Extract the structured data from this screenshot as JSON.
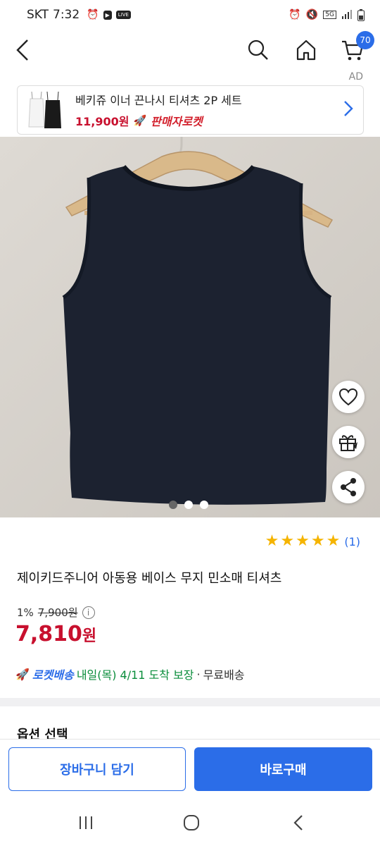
{
  "status_bar": {
    "carrier": "SKT",
    "time": "7:32",
    "live_badge": "LIVE",
    "network": "5G"
  },
  "header": {
    "cart_count": "70"
  },
  "ad": {
    "label": "AD",
    "title": "베키쥬 이너 끈나시 티셔츠 2P 세트",
    "price": "11,900원",
    "badge": "판매자로켓"
  },
  "gallery": {
    "total": 3,
    "active_index": 0
  },
  "rating": {
    "stars": 5,
    "count": "(1)"
  },
  "product": {
    "title": "제이키드주니어 아동용 베이스 무지 민소매 티셔츠",
    "discount": "1%",
    "original_price": "7,900원",
    "price_value": "7,810",
    "price_unit": "원"
  },
  "delivery": {
    "rocket": "로켓배송",
    "arrival": "내일(목) 4/11 도착 보장",
    "separator": "·",
    "shipping": "무료배송"
  },
  "options": {
    "title": "옵션 선택"
  },
  "actions": {
    "add_to_cart": "장바구니 담기",
    "buy_now": "바로구매"
  },
  "colors": {
    "accent": "#2b6de8",
    "price": "#c8102e",
    "arrival": "#0a8d3b",
    "star": "#f5b400"
  }
}
